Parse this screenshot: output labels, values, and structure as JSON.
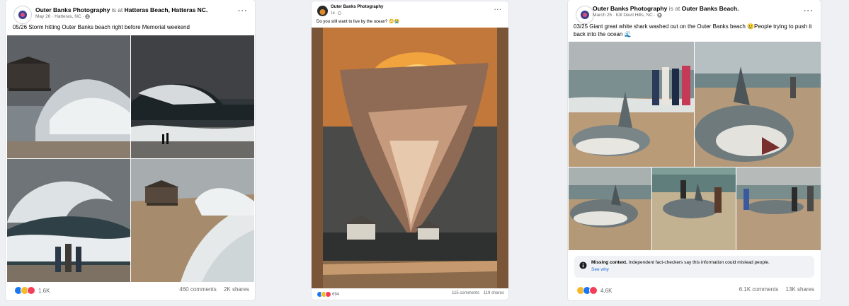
{
  "posts": [
    {
      "page_name": "Outer Banks Photography",
      "is_at": "is at",
      "location": "Hatteras Beach, Hatteras NC.",
      "date": "May 26 · Hatteras, NC ·",
      "caption": "05/26 Storm hitting Outer Banks beach right before Memorial weekend",
      "reaction_count": "1.6K",
      "comments": "460 comments",
      "shares": "2K shares"
    },
    {
      "page_name": "Outer Banks Photography",
      "date": "1d ·",
      "caption": "Do you still want to live by the ocean? 😳😭",
      "reaction_count": "694",
      "comments": "115 comments",
      "shares": "119 shares"
    },
    {
      "page_name": "Outer Banks Photography",
      "is_at": "is at",
      "location": "Outer Banks Beach.",
      "date": "March 25 · Kill Devil Hills, NC ·",
      "caption": "03/25 Giant great white shark washed out on the Outer Banks beach 😢People trying to push it back into the ocean 🌊",
      "notice_title": "Missing context.",
      "notice_text": "Independent fact-checkers say this information could mislead people.",
      "notice_link": "See why",
      "reaction_count": "4.6K",
      "comments": "6.1K comments",
      "shares": "13K shares"
    }
  ],
  "more_label": "···"
}
